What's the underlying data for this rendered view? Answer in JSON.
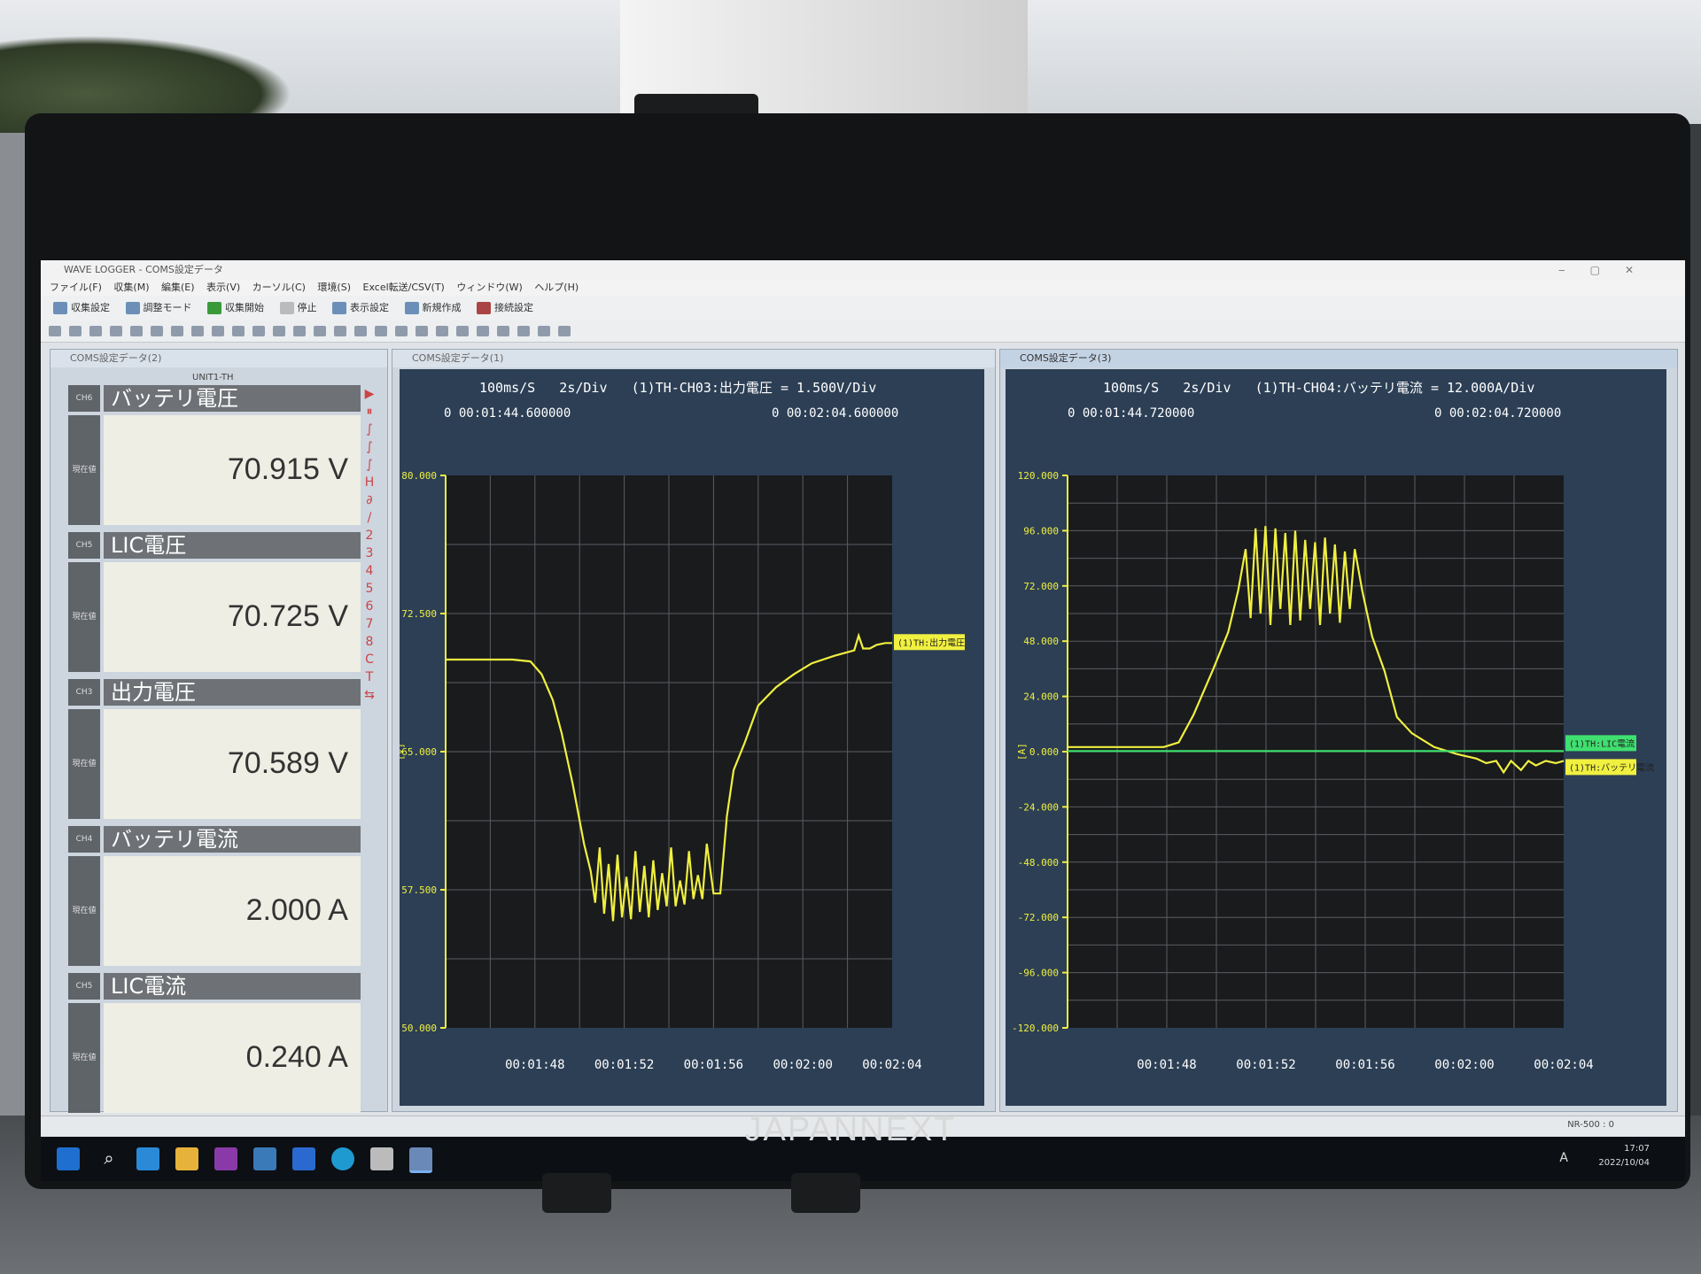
{
  "app": {
    "title": "WAVE LOGGER - COMS設定データ",
    "menu": [
      "ファイル(F)",
      "収集(M)",
      "編集(E)",
      "表示(V)",
      "カーソル(C)",
      "環境(S)",
      "Excel転送/CSV(T)",
      "ウィンドウ(W)",
      "ヘルプ(H)"
    ],
    "toolbar": [
      "収集設定",
      "調整モード",
      "収集開始",
      "停止",
      "表示設定",
      "新規作成",
      "接続設定"
    ]
  },
  "windows": {
    "left_title": "COMS設定データ(2)",
    "mid_title": "COMS設定データ(1)",
    "right_title": "COMS設定データ(3)"
  },
  "meters": {
    "unit": "UNIT1-TH",
    "current_label": "現在値",
    "items": [
      {
        "ch": "CH6",
        "name": "バッテリ電圧",
        "value": "70.915 V"
      },
      {
        "ch": "CH5",
        "name": "LIC電圧",
        "value": "70.725 V"
      },
      {
        "ch": "CH3",
        "name": "出力電圧",
        "value": "70.589 V"
      },
      {
        "ch": "CH4",
        "name": "バッテリ電流",
        "value": "2.000 A"
      },
      {
        "ch": "CH5",
        "name": "LIC電流",
        "value": "0.240 A"
      }
    ]
  },
  "chart_data": [
    {
      "type": "line",
      "header": "100ms/S   2s/Div   (1)TH-CH03:出力電圧 = 1.500V/Div",
      "cursor_left": "0 00:01:44.600000",
      "cursor_right": "0 00:02:04.600000",
      "ylabel": "[V]",
      "ylim": [
        50,
        80
      ],
      "yticks": [
        "80.000",
        "72.500",
        "65.000",
        "57.500",
        "50.000"
      ],
      "xticks": [
        "00:01:48",
        "00:01:52",
        "00:01:56",
        "00:02:00",
        "00:02:04"
      ],
      "xlim": [
        104.6,
        124.6
      ],
      "grid": true,
      "legend": [
        "(1)TH:出力電圧"
      ],
      "series": [
        {
          "name": "(1)TH:出力電圧",
          "color": "#f0f040",
          "x": [
            104.6,
            106.0,
            107.6,
            108.4,
            108.9,
            109.4,
            109.8,
            110.3,
            110.8,
            111.1,
            111.3,
            111.5,
            111.7,
            111.9,
            112.1,
            112.3,
            112.5,
            112.7,
            112.9,
            113.1,
            113.3,
            113.5,
            113.7,
            113.9,
            114.1,
            114.3,
            114.5,
            114.7,
            114.9,
            115.1,
            115.3,
            115.5,
            115.7,
            115.9,
            116.1,
            116.3,
            116.6,
            116.9,
            117.2,
            117.5,
            118.0,
            118.6,
            119.4,
            120.2,
            121.0,
            122.0,
            122.9,
            123.1,
            123.3,
            123.6,
            123.9,
            124.3,
            124.6
          ],
          "y": [
            70.0,
            70.0,
            70.0,
            69.9,
            69.2,
            67.8,
            66.0,
            63.2,
            60.0,
            58.5,
            56.8,
            59.8,
            56.2,
            58.9,
            55.8,
            59.4,
            56.0,
            58.2,
            55.9,
            59.6,
            56.3,
            58.8,
            56.0,
            59.1,
            56.4,
            58.4,
            56.6,
            59.8,
            56.6,
            58.0,
            56.7,
            59.6,
            57.0,
            58.3,
            57.0,
            60.0,
            57.3,
            57.3,
            61.5,
            64.0,
            65.5,
            67.5,
            68.5,
            69.2,
            69.8,
            70.2,
            70.5,
            71.3,
            70.6,
            70.6,
            70.8,
            70.9,
            70.9
          ]
        }
      ]
    },
    {
      "type": "line",
      "header": "100ms/S   2s/Div   (1)TH-CH04:バッテリ電流 = 12.000A/Div",
      "cursor_left": "0 00:01:44.720000",
      "cursor_right": "0 00:02:04.720000",
      "ylabel": "[A]",
      "ylim": [
        -120,
        120
      ],
      "yticks": [
        "120.000",
        "96.000",
        "72.000",
        "48.000",
        "24.000",
        "0.000",
        "-24.000",
        "-48.000",
        "-72.000",
        "-96.000",
        "-120.000"
      ],
      "xticks": [
        "00:01:48",
        "00:01:52",
        "00:01:56",
        "00:02:00",
        "00:02:04"
      ],
      "xlim": [
        104.72,
        124.72
      ],
      "grid": true,
      "legend": [
        "(1)TH:LIC電流",
        "(1)TH:バッテリ電流"
      ],
      "series": [
        {
          "name": "(1)TH:バッテリ電流",
          "color": "#f0f040",
          "x": [
            104.72,
            108.6,
            109.2,
            109.8,
            110.6,
            111.2,
            111.6,
            111.9,
            112.1,
            112.3,
            112.5,
            112.7,
            112.9,
            113.1,
            113.3,
            113.5,
            113.7,
            113.9,
            114.1,
            114.3,
            114.5,
            114.7,
            114.9,
            115.1,
            115.3,
            115.5,
            115.7,
            115.9,
            116.1,
            116.3,
            116.6,
            117.0,
            117.5,
            118.0,
            118.6,
            119.5,
            120.4,
            121.2,
            121.6,
            122.0,
            122.3,
            122.6,
            123.0,
            123.3,
            123.6,
            124.0,
            124.4,
            124.72
          ],
          "y": [
            2.0,
            2.0,
            4.0,
            16.0,
            36.0,
            52.0,
            70.0,
            88.0,
            58.0,
            97.0,
            60.0,
            98.0,
            55.0,
            97.0,
            62.0,
            95.0,
            55.0,
            96.0,
            57.0,
            92.0,
            62.0,
            91.0,
            55.0,
            93.0,
            60.0,
            90.0,
            56.0,
            87.0,
            62.0,
            88.0,
            70.0,
            50.0,
            35.0,
            15.0,
            8.0,
            2.0,
            -1.0,
            -3.0,
            -5.0,
            -4.0,
            -9.0,
            -4.0,
            -8.0,
            -4.0,
            -6.0,
            -4.0,
            -5.0,
            -4.0
          ]
        },
        {
          "name": "(1)TH:LIC電流",
          "color": "#40e070",
          "x": [
            104.72,
            124.72
          ],
          "y": [
            0.24,
            0.24
          ]
        }
      ]
    }
  ],
  "statusbar": {
    "right": "NR-500 : 0"
  },
  "taskbar": {
    "time": "17:07",
    "date": "2022/10/04",
    "ime": "A"
  },
  "brand": "JAPANNEXT"
}
